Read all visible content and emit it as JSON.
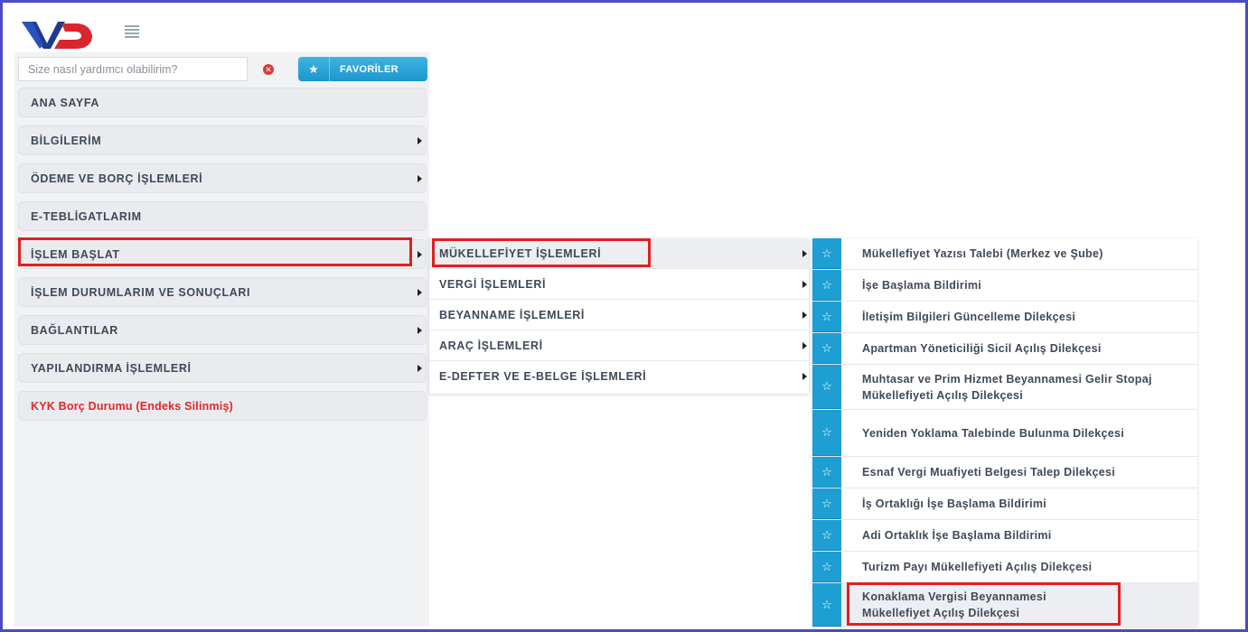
{
  "search": {
    "placeholder": "Size nasıl yardımcı olabilirim?"
  },
  "favorites_button": {
    "label": "FAVORİLER",
    "icon": "star-icon"
  },
  "clear_button": {
    "icon": "close-circle-icon",
    "color": "#d93a3a"
  },
  "brand": {
    "logo_text": "VD",
    "accent_blue": "#1e9fd4",
    "highlight_red": "#e02020"
  },
  "main_menu": [
    {
      "label": "ANA SAYFA",
      "has_submenu": false
    },
    {
      "label": "BİLGİLERİM",
      "has_submenu": true
    },
    {
      "label": "ÖDEME VE BORÇ İŞLEMLERİ",
      "has_submenu": true
    },
    {
      "label": "E-TEBLİGATLARIM",
      "has_submenu": false
    },
    {
      "label": "İŞLEM BAŞLAT",
      "has_submenu": true,
      "highlighted": true
    },
    {
      "label": "İŞLEM DURUMLARIM VE SONUÇLARI",
      "has_submenu": true
    },
    {
      "label": "BAĞLANTILAR",
      "has_submenu": true
    },
    {
      "label": "YAPILANDIRMA İŞLEMLERİ",
      "has_submenu": true
    },
    {
      "label": "KYK Borç Durumu (Endeks Silinmiş)",
      "has_submenu": false,
      "color": "#e02828"
    }
  ],
  "submenu": [
    {
      "label": "MÜKELLEFİYET İŞLEMLERİ",
      "highlighted": true
    },
    {
      "label": "VERGİ İŞLEMLERİ"
    },
    {
      "label": "BEYANNAME İŞLEMLERİ"
    },
    {
      "label": "ARAÇ İŞLEMLERİ"
    },
    {
      "label": "E-DEFTER VE E-BELGE İŞLEMLERİ"
    }
  ],
  "operations": [
    {
      "label": "Mükellefiyet Yazısı Talebi (Merkez ve Şube)"
    },
    {
      "label": "İşe Başlama Bildirimi"
    },
    {
      "label": "İletişim Bilgileri Güncelleme Dilekçesi"
    },
    {
      "label": "Apartman Yöneticiliği Sicil Açılış Dilekçesi"
    },
    {
      "label": "Muhtasar ve Prim Hizmet Beyannamesi Gelir Stopaj Mükellefiyeti Açılış Dilekçesi"
    },
    {
      "label": "Yeniden Yoklama Talebinde Bulunma Dilekçesi"
    },
    {
      "label": "Esnaf Vergi Muafiyeti Belgesi Talep Dilekçesi"
    },
    {
      "label": "İş Ortaklığı İşe Başlama Bildirimi"
    },
    {
      "label": "Adi Ortaklık İşe Başlama Bildirimi"
    },
    {
      "label": "Turizm Payı Mükellefiyeti Açılış Dilekçesi"
    },
    {
      "label": "Konaklama Vergisi Beyannamesi Mükellefiyet Açılış Dilekçesi",
      "highlighted": true
    }
  ]
}
